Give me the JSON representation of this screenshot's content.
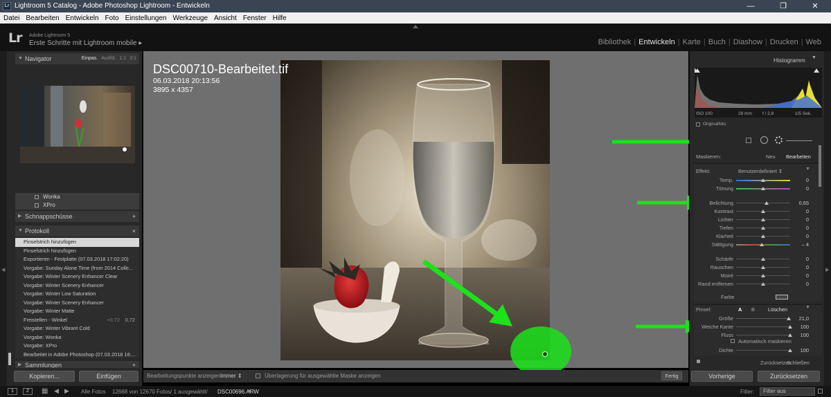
{
  "window": {
    "title": "Lightroom 5 Catalog - Adobe Photoshop Lightroom - Entwickeln",
    "app_icon": "Lr",
    "minimize_icon": "—",
    "maximize_icon": "❐",
    "close_icon": "✕"
  },
  "menu": [
    "Datei",
    "Bearbeiten",
    "Entwickeln",
    "Foto",
    "Einstellungen",
    "Werkzeuge",
    "Ansicht",
    "Fenster",
    "Hilfe"
  ],
  "identity": {
    "logo": "Lr",
    "version": "Adobe Lightroom 5",
    "catalog": "Erste Schritte mit Lightroom mobile",
    "catalog_arrow": "▸"
  },
  "modules": [
    {
      "label": "Bibliothek",
      "active": false
    },
    {
      "label": "Entwickeln",
      "active": true
    },
    {
      "label": "Karte",
      "active": false
    },
    {
      "label": "Buch",
      "active": false
    },
    {
      "label": "Diashow",
      "active": false
    },
    {
      "label": "Drucken",
      "active": false
    },
    {
      "label": "Web",
      "active": false
    }
  ],
  "left": {
    "navigator": {
      "title": "Navigator",
      "options": [
        "Einpas.",
        "Ausfül.",
        "1:1",
        "3:1"
      ],
      "selected": "Einpas."
    },
    "presets": [
      "Wonka",
      "XPro"
    ],
    "snapshots": {
      "title": "Schnappschüsse",
      "add": "+"
    },
    "history": {
      "title": "Protokoll",
      "close": "×",
      "items": [
        {
          "label": "Pinselstrich hinzufügen",
          "selected": true
        },
        {
          "label": "Pinselstrich hinzufügen"
        },
        {
          "label": "Exportieren - Festplatte (07.03.2018 17:02:20)"
        },
        {
          "label": "Vorgabe: Sunday Alone Time (from 2014 Colle..."
        },
        {
          "label": "Vorgabe: Winter Scenery Enhancer Clear"
        },
        {
          "label": "Vorgabe: Winter Scenery Enhancer"
        },
        {
          "label": "Vorgabe: Winter Low Saturation"
        },
        {
          "label": "Vorgabe: Winter Scenery Enhancer"
        },
        {
          "label": "Vorgabe: Winter Matte"
        },
        {
          "label": "Freistellen - Winkel",
          "n1": "+0,72",
          "n2": "0,72"
        },
        {
          "label": "Vorgabe: Winter Vibrant Cold"
        },
        {
          "label": "Vorgabe: Wonka"
        },
        {
          "label": "Vorgabe: XPro"
        },
        {
          "label": "Bearbeitet in Adobe Photoshop (07.03.2018 16:..."
        }
      ]
    },
    "collections": {
      "title": "Sammlungen",
      "add": "+"
    },
    "copy_button": "Kopieren...",
    "paste_button": "Einfügen"
  },
  "photo": {
    "filename": "DSC00710-Bearbeitet.tif",
    "datetime": "06.03.2018 20:13:56",
    "dimensions": "3895 x 4357"
  },
  "toolbar": {
    "edit_points_label": "Bearbeitungspunkte anzeigen:",
    "edit_points_value": "Immer",
    "overlay_label": "Überlagerung für ausgewählte Maske anzeigen",
    "done": "Fertig"
  },
  "right": {
    "histogram": {
      "title": "Histogramm",
      "iso": "ISO 100",
      "focal": "28 mm",
      "aperture": "f / 2,8",
      "shutter": "1/5 Sek.",
      "original": "Originalfoto"
    },
    "mask": {
      "label": "Maskieren:",
      "new": "Neu",
      "edit": "Bearbeiten"
    },
    "effect": {
      "label": "Effekt:",
      "value": "Benutzerdefiniert"
    },
    "sliders": [
      {
        "label": "Temp.",
        "value": "0",
        "pos": 0.5,
        "gradient": "temp"
      },
      {
        "label": "Tönung",
        "value": "0",
        "pos": 0.5,
        "gradient": "tint"
      },
      {
        "label": "Belichtung",
        "value": "0,65",
        "pos": 0.56
      },
      {
        "label": "Kontrast",
        "value": "0",
        "pos": 0.5
      },
      {
        "label": "Lichter",
        "value": "0",
        "pos": 0.5
      },
      {
        "label": "Tiefen",
        "value": "0",
        "pos": 0.5
      },
      {
        "label": "Klarheit",
        "value": "0",
        "pos": 0.5
      },
      {
        "label": "Sättigung",
        "value": "– 4",
        "pos": 0.48,
        "gradient": "sat"
      },
      {
        "label": "Schärfe",
        "value": "0",
        "pos": 0.5
      },
      {
        "label": "Rauschen",
        "value": "0",
        "pos": 0.5
      },
      {
        "label": "Moiré",
        "value": "0",
        "pos": 0.5
      },
      {
        "label": "Rand entfernen",
        "value": "0",
        "pos": 0.5
      }
    ],
    "color_label": "Farbe",
    "brush": {
      "label": "Pinsel:",
      "a": "A",
      "b": "B",
      "erase": "Löschen",
      "size_label": "Größe",
      "size_value": "21,0",
      "size_pos": 0.97,
      "feather_label": "Weiche Kante",
      "feather_value": "100",
      "feather_pos": 1.0,
      "flow_label": "Fluss",
      "flow_value": "100",
      "flow_pos": 1.0,
      "automask": "Automatisch maskieren",
      "density_label": "Dichte",
      "density_value": "100",
      "density_pos": 1.0
    },
    "reset": "Zurücksetzen",
    "close": "Schließen",
    "previous_button": "Vorherige",
    "reset_button": "Zurücksetzen"
  },
  "status": {
    "page1": "1",
    "page2": "2",
    "source": "Alle Fotos",
    "count": "12668 von 12670 Fotos/ 1 ausgewählt/",
    "file": "DSC00696.ARW",
    "filter_label": "Filter:",
    "filter_value": "Filter aus"
  },
  "colors": {
    "annotation_green": "#1be21b",
    "panel_bg": "#282828",
    "center_bg": "#6f6f6f"
  }
}
